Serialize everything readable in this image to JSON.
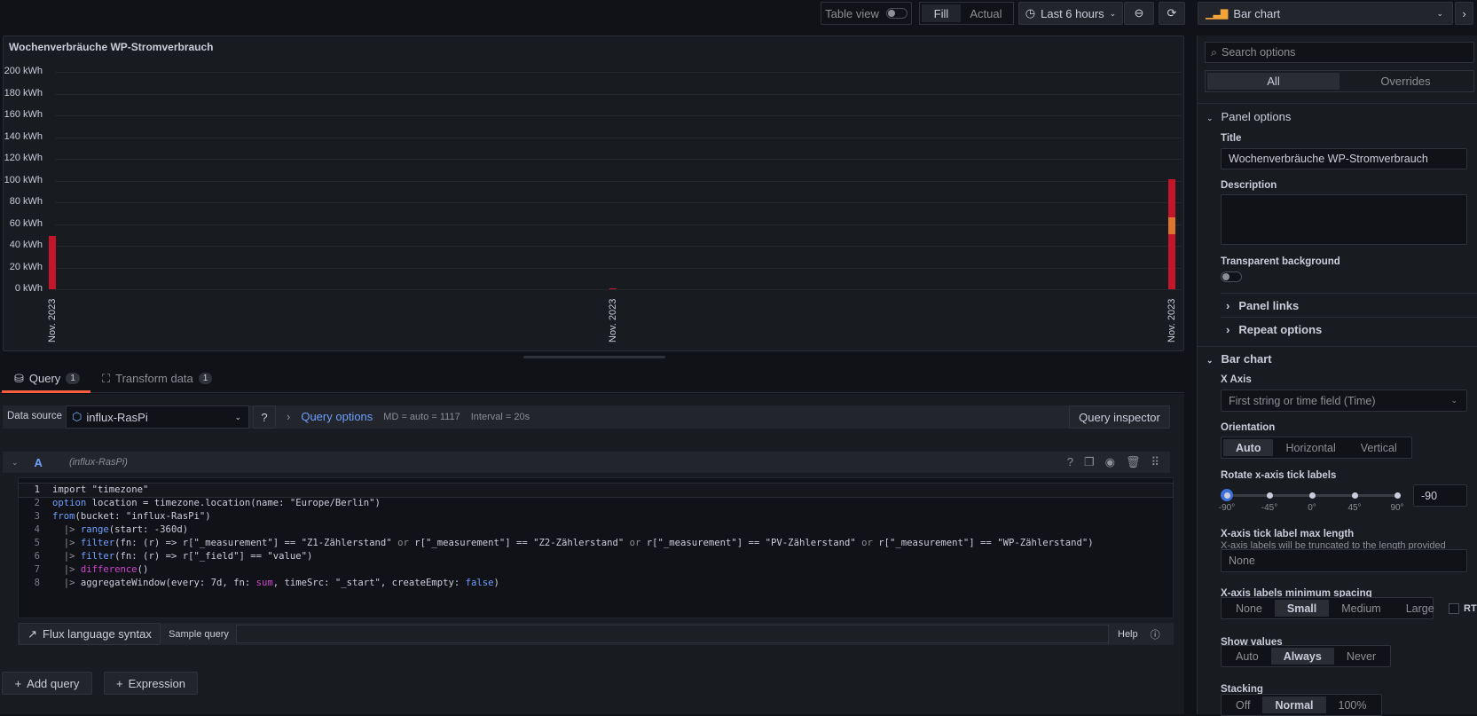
{
  "toolbar": {
    "table_view": "Table view",
    "fill": "Fill",
    "actual": "Actual",
    "time_range": "Last 6 hours",
    "viz": "Bar chart"
  },
  "panel": {
    "title": "Wochenverbräuche WP-Stromverbrauch"
  },
  "chart_data": {
    "type": "bar",
    "stacking": "normal",
    "categories": [
      "Nov. 2023",
      "Nov. 2023",
      "Nov. 2023"
    ],
    "yticks": [
      "0 kWh",
      "20 kWh",
      "40 kWh",
      "60 kWh",
      "80 kWh",
      "100 kWh",
      "120 kWh",
      "140 kWh",
      "160 kWh",
      "180 kWh",
      "200 kWh"
    ],
    "ylim": [
      0,
      200
    ],
    "unit": "kWh",
    "grid": true,
    "series": [
      {
        "values": [
          49,
          1,
          51
        ],
        "color": "#c4162a"
      },
      {
        "values": [
          0,
          0,
          15
        ],
        "color": "#e0752d"
      },
      {
        "values": [
          0,
          0,
          35
        ],
        "color": "#c4162a"
      }
    ]
  },
  "tabs": [
    {
      "label": "Query",
      "count": "1"
    },
    {
      "label": "Transform data",
      "count": "1"
    }
  ],
  "query_bar": {
    "ds_label": "Data source",
    "ds_value": "influx-RasPi",
    "query_options": "Query options",
    "md": "MD = auto = 1117",
    "interval": "Interval = 20s",
    "inspector": "Query inspector"
  },
  "query": {
    "ref": "A",
    "ds": "(influx-RasPi)",
    "lines": [
      [
        [
          "import \"timezone\"",
          ""
        ]
      ],
      [
        [
          "option",
          "kw"
        ],
        [
          " location = timezone.location(name: \"Europe/Berlin\")",
          ""
        ]
      ],
      [
        [
          "from",
          "kw"
        ],
        [
          "(bucket: \"influx-RasPi\")",
          ""
        ]
      ],
      [
        [
          "  |> ",
          "op"
        ],
        [
          "range",
          "kw"
        ],
        [
          "(start: -360d)",
          ""
        ]
      ],
      [
        [
          "  |> ",
          "op"
        ],
        [
          "filter",
          "kw"
        ],
        [
          "(fn: (r) => r[\"_measurement\"] == \"Z1-Zählerstand\" ",
          ""
        ],
        [
          "or",
          "op"
        ],
        [
          " r[\"_measurement\"] == \"Z2-Zählerstand\" ",
          ""
        ],
        [
          "or",
          "op"
        ],
        [
          " r[\"_measurement\"] == \"PV-Zählerstand\" ",
          ""
        ],
        [
          "or",
          "op"
        ],
        [
          " r[\"_measurement\"] == \"WP-Zählerstand\")",
          ""
        ]
      ],
      [
        [
          "  |> ",
          "op"
        ],
        [
          "filter",
          "kw"
        ],
        [
          "(fn: (r) => r[\"_field\"] == \"value\")",
          ""
        ]
      ],
      [
        [
          "  |> ",
          "op"
        ],
        [
          "difference",
          "fnm"
        ],
        [
          "()",
          ""
        ]
      ],
      [
        [
          "  |> ",
          "op"
        ],
        [
          "aggregateWindow(every: 7d, fn: ",
          ""
        ],
        [
          "sum",
          "fnm"
        ],
        [
          ", timeSrc: \"_start\", createEmpty: ",
          ""
        ],
        [
          "false",
          "kw"
        ],
        [
          ")",
          ""
        ]
      ]
    ]
  },
  "editor_footer": {
    "syntax": "Flux language syntax",
    "sample": "Sample query",
    "help": "Help"
  },
  "actions": {
    "add_query": "Add query",
    "expression": "Expression"
  },
  "options": {
    "search_placeholder": "Search options",
    "all": "All",
    "overrides": "Overrides",
    "panel_options": "Panel options",
    "title_label": "Title",
    "title_value": "Wochenverbräuche WP-Stromverbrauch",
    "description_label": "Description",
    "transparent_label": "Transparent background",
    "transparent": false,
    "panel_links": "Panel links",
    "repeat_options": "Repeat options",
    "bar_chart": "Bar chart",
    "x_axis_label": "X Axis",
    "x_axis_placeholder": "First string or time field (Time)",
    "orientation_label": "Orientation",
    "orientation": [
      "Auto",
      "Horizontal",
      "Vertical"
    ],
    "rotate_label": "Rotate x-axis tick labels",
    "rotate_ticks": [
      "-90°",
      "-45°",
      "0°",
      "45°",
      "90°"
    ],
    "rotate_value": "-90",
    "maxlen_label": "X-axis tick label max length",
    "maxlen_desc": "X-axis labels will be truncated to the length provided",
    "maxlen_placeholder": "None",
    "spacing_label": "X-axis labels minimum spacing",
    "spacing": [
      "None",
      "Small",
      "Medium",
      "Large"
    ],
    "rtl": "RTL",
    "show_values_label": "Show values",
    "show_values": [
      "Auto",
      "Always",
      "Never"
    ],
    "stacking_label": "Stacking",
    "stacking": [
      "Off",
      "Normal",
      "100%"
    ]
  }
}
